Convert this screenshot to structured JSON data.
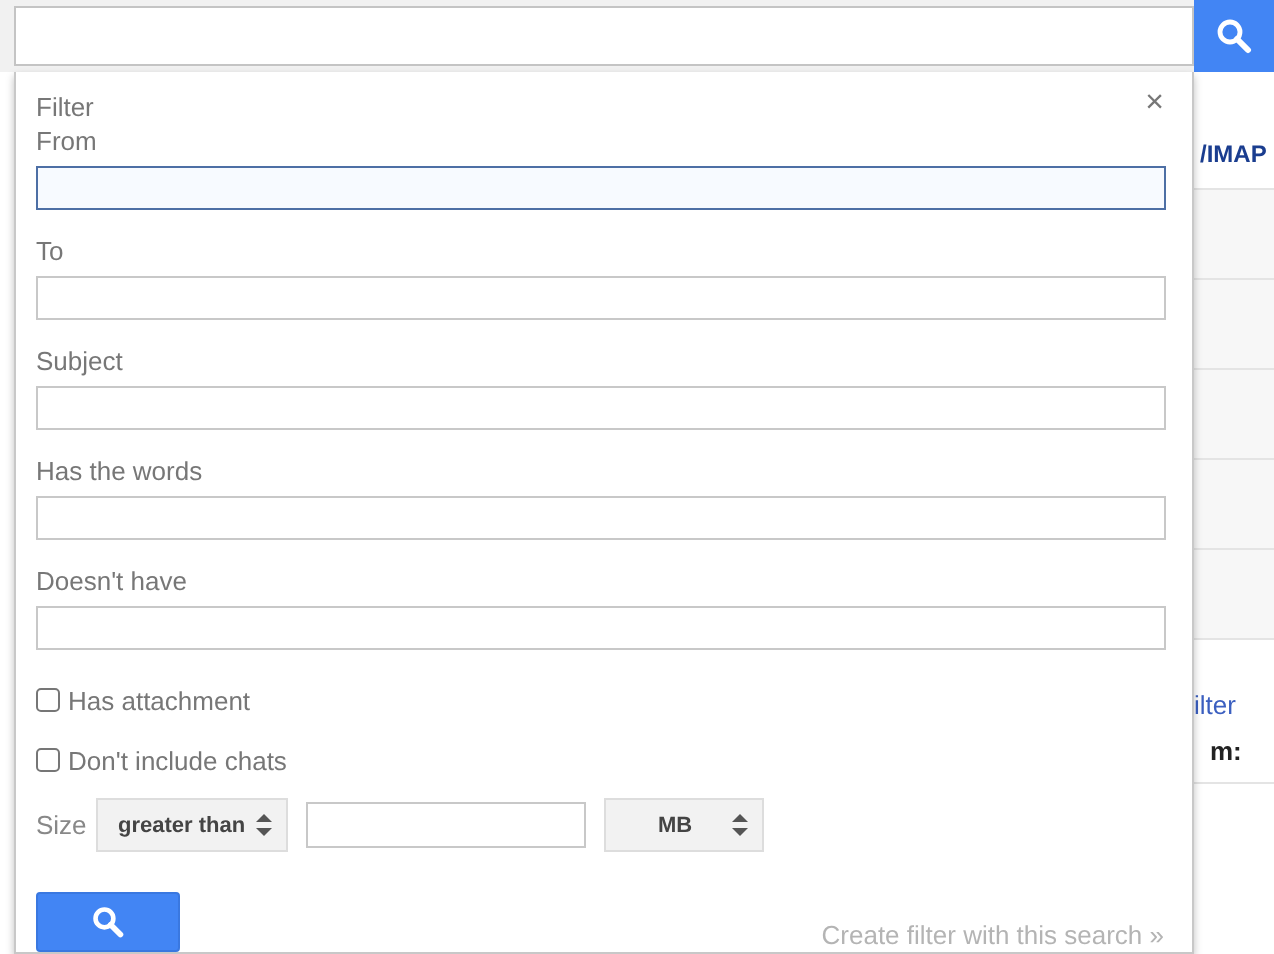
{
  "filter_panel": {
    "title": "Filter",
    "close": "×",
    "fields": [
      {
        "label": "From",
        "focused": true
      },
      {
        "label": "To",
        "focused": false
      },
      {
        "label": "Subject",
        "focused": false
      },
      {
        "label": "Has the words",
        "focused": false
      },
      {
        "label": "Doesn't have",
        "focused": false
      }
    ],
    "checkboxes": [
      {
        "label": "Has attachment",
        "checked": false
      },
      {
        "label": "Don't include chats",
        "checked": false
      }
    ],
    "size": {
      "label": "Size",
      "operator": "greater than",
      "unit": "MB"
    },
    "create_link": "Create filter with this search »"
  },
  "background": [
    {
      "kind": "heading",
      "text": "/IMAP"
    },
    {
      "kind": "blank"
    },
    {
      "kind": "blank"
    },
    {
      "kind": "blank"
    },
    {
      "kind": "blank"
    },
    {
      "kind": "blank"
    },
    {
      "kind": "link",
      "text": "ilter"
    },
    {
      "kind": "label",
      "text": "m:"
    }
  ]
}
